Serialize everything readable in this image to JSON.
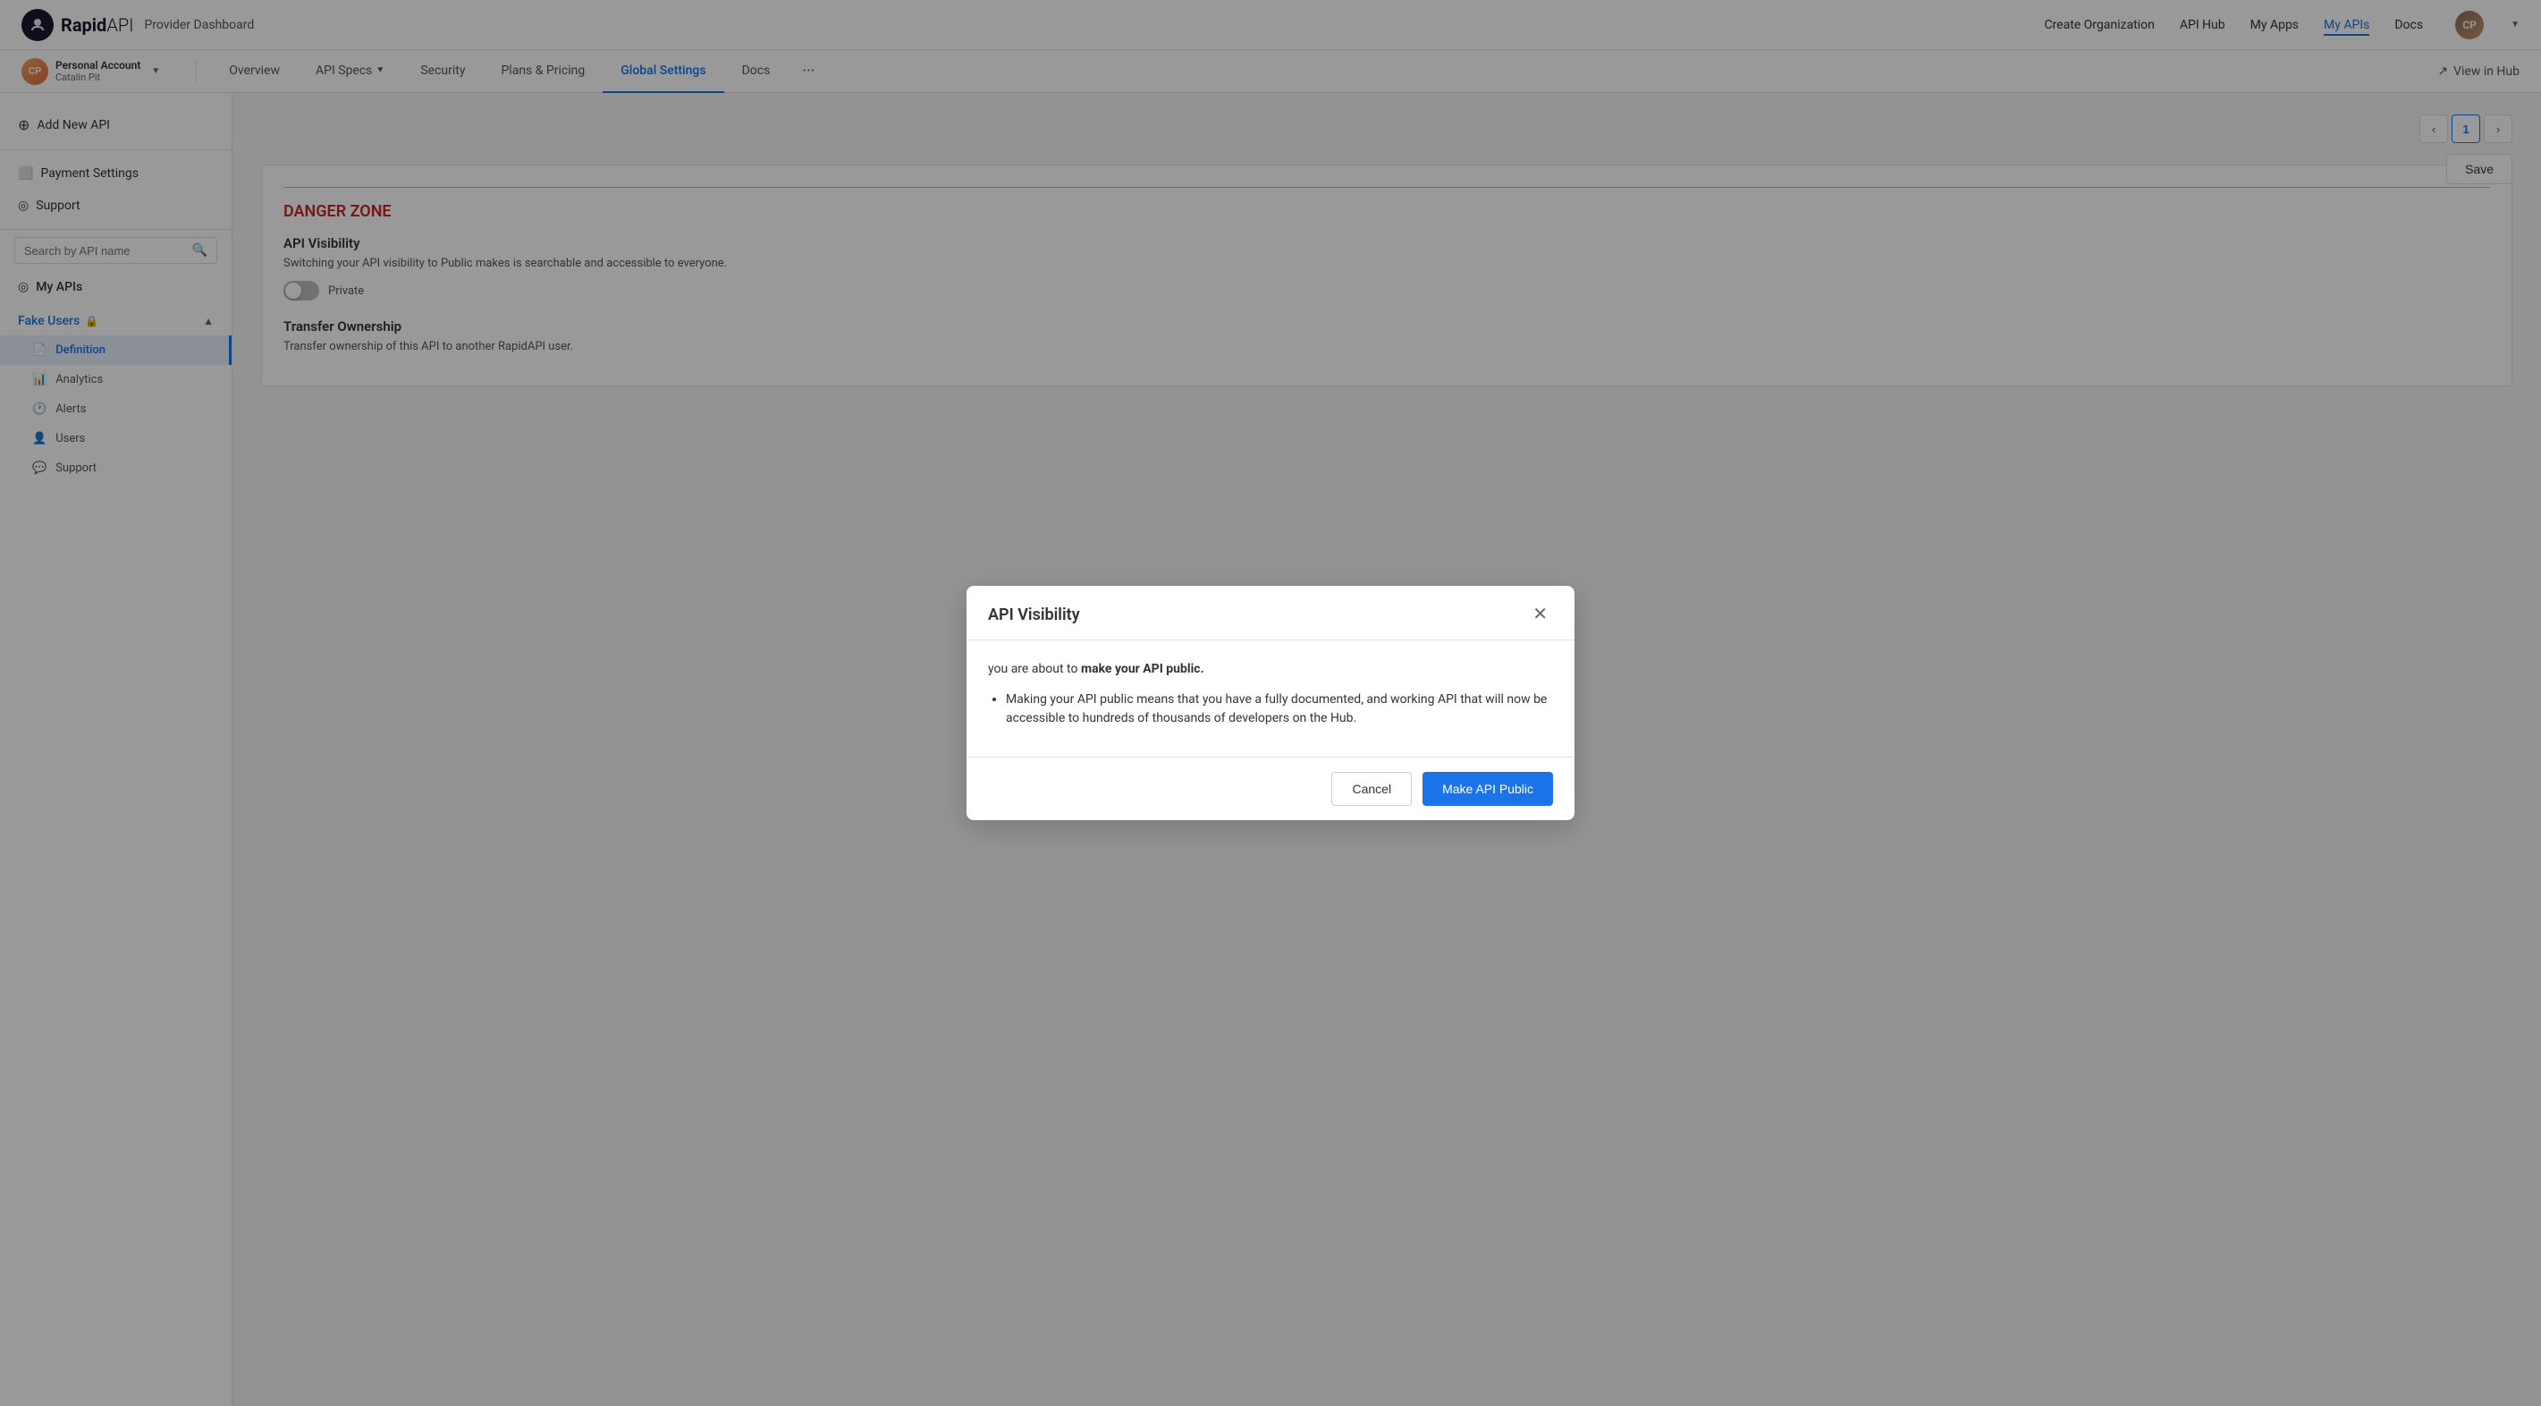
{
  "topNav": {
    "logo": "Rapid",
    "logoSuffix": "API",
    "subtitle": "Provider Dashboard",
    "links": [
      {
        "label": "Create Organization",
        "active": false
      },
      {
        "label": "API Hub",
        "active": false
      },
      {
        "label": "My Apps",
        "active": false
      },
      {
        "label": "My APIs",
        "active": true
      },
      {
        "label": "Docs",
        "active": false
      }
    ],
    "avatarInitials": "CP"
  },
  "secondNav": {
    "accountName": "Personal Account",
    "accountSub": "Catalin Pit",
    "tabs": [
      {
        "label": "Overview",
        "active": false
      },
      {
        "label": "API Specs",
        "active": false,
        "hasChevron": true
      },
      {
        "label": "Security",
        "active": false
      },
      {
        "label": "Plans & Pricing",
        "active": false
      },
      {
        "label": "Global Settings",
        "active": true
      },
      {
        "label": "Docs",
        "active": false
      }
    ],
    "moreLabel": "···",
    "viewInHub": "View in Hub"
  },
  "sidebar": {
    "addNewAPI": "Add New API",
    "paymentSettings": "Payment Settings",
    "support": "Support",
    "searchPlaceholder": "Search by API name",
    "myAPIs": "My APIs",
    "apiName": "Fake Users",
    "subItems": [
      {
        "label": "Definition",
        "active": true,
        "icon": "📄"
      },
      {
        "label": "Analytics",
        "active": false,
        "icon": "📊"
      },
      {
        "label": "Alerts",
        "active": false,
        "icon": "🕐"
      },
      {
        "label": "Users",
        "active": false,
        "icon": "👤"
      },
      {
        "label": "Support",
        "active": false,
        "icon": "💬"
      }
    ]
  },
  "pagination": {
    "prevLabel": "‹",
    "currentPage": "1",
    "nextLabel": "›"
  },
  "saveBtn": "Save",
  "dangerZone": {
    "title": "DANGER ZONE",
    "apiVisibility": {
      "heading": "API Visibility",
      "description": "Switching your API visibility to Public makes is searchable and accessible to everyone.",
      "toggleLabel": "Private"
    },
    "transferOwnership": {
      "heading": "Transfer Ownership",
      "description": "Transfer ownership of this API to another RapidAPI user."
    }
  },
  "modal": {
    "title": "API Visibility",
    "intro": "you are about to ",
    "introStrong": "make your API public.",
    "bulletPoints": [
      "Making your API public means that you have a fully documented, and working API that will now be accessible to hundreds of thousands of developers on the Hub."
    ],
    "cancelLabel": "Cancel",
    "confirmLabel": "Make API Public"
  }
}
